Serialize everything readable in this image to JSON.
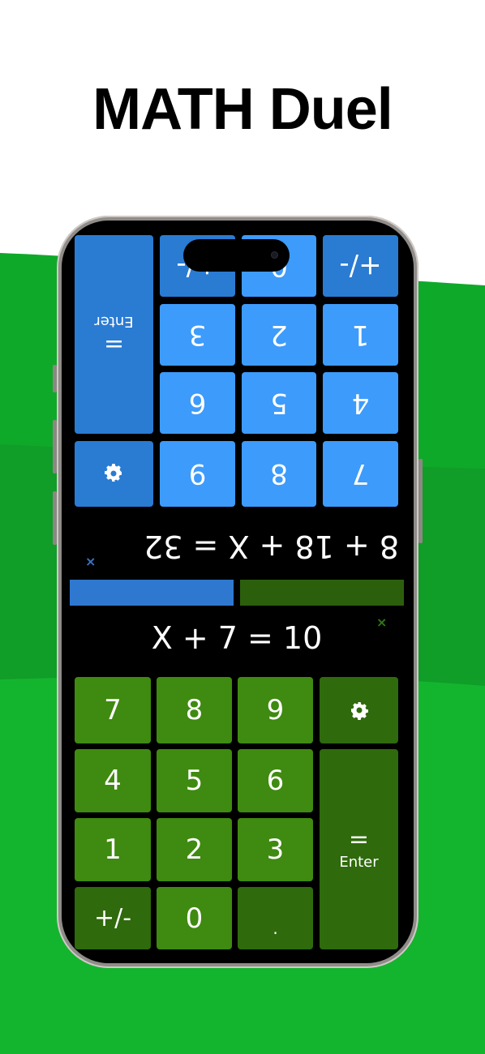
{
  "headline": "MATH Duel",
  "colors": {
    "blue_key": "#3d9bfb",
    "blue_key_dark": "#2a7bd2",
    "green_key": "#3f8a10",
    "green_key_dark": "#2f6a0c",
    "background_green": "#12b32c",
    "screen": "#000000"
  },
  "top_player": {
    "equation": "8 + 18 + X = 32",
    "close_mark": "×",
    "keys": {
      "k7": "7",
      "k8": "8",
      "k9": "9",
      "k4": "4",
      "k5": "5",
      "k6": "6",
      "k1": "1",
      "k2": "2",
      "k3": "3",
      "k0": "0",
      "sign": "+/-",
      "enter_symbol": "=",
      "enter_label": "Enter",
      "settings_icon": "gear-icon"
    }
  },
  "progress": {
    "top_player_share": 0.5,
    "bottom_player_share": 0.5
  },
  "bottom_player": {
    "equation": "X + 7 = 10",
    "close_mark": "×",
    "keys": {
      "k7": "7",
      "k8": "8",
      "k9": "9",
      "k4": "4",
      "k5": "5",
      "k6": "6",
      "k1": "1",
      "k2": "2",
      "k3": "3",
      "k0": "0",
      "sign": "+/-",
      "decimal": ".",
      "enter_symbol": "=",
      "enter_label": "Enter",
      "settings_icon": "gear-icon"
    }
  }
}
